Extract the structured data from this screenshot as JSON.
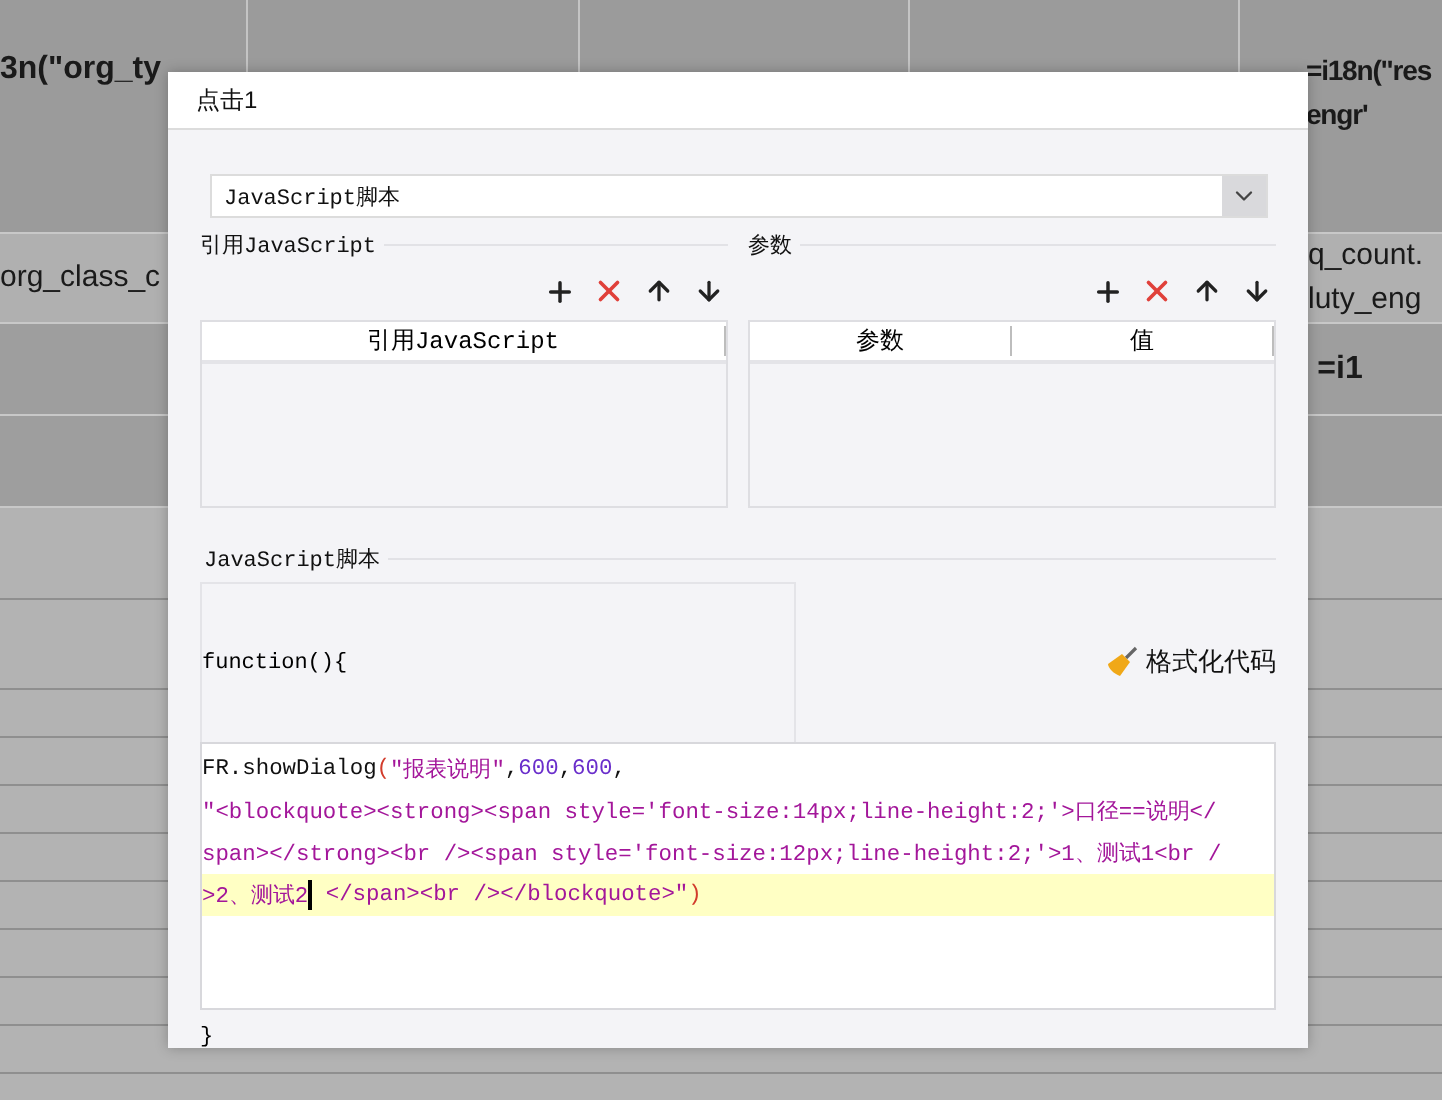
{
  "sheet": {
    "rows": [
      {
        "kind": "header",
        "cells": [
          "3n(\"org_ty",
          null,
          null,
          null,
          "=i18n(\"res\nengr'"
        ]
      },
      {
        "kind": "light",
        "cells": [
          "org_class_c",
          null,
          null,
          null,
          "q_count.\nluty_eng"
        ]
      },
      {
        "kind": "dark",
        "cells": [
          null,
          null,
          null,
          null,
          "=i1"
        ]
      },
      {
        "kind": "dark",
        "cells": [
          null,
          null,
          null,
          null,
          null
        ]
      }
    ]
  },
  "dialog": {
    "title": "点击1",
    "type_select": {
      "value": "JavaScript脚本"
    },
    "imports": {
      "heading": "引用JavaScript",
      "columns": [
        "引用JavaScript"
      ]
    },
    "params": {
      "heading": "参数",
      "columns": [
        "参数",
        "值"
      ]
    },
    "script": {
      "heading": "JavaScript脚本",
      "header_line": "function(){",
      "format_button": "格式化代码",
      "code_lines": [
        {
          "current": false,
          "tokens": [
            {
              "kind": "plain",
              "text": "FR.showDialog"
            },
            {
              "kind": "paren",
              "text": "("
            },
            {
              "kind": "string",
              "text": "\"报表说明\""
            },
            {
              "kind": "plain",
              "text": ","
            },
            {
              "kind": "number",
              "text": "600"
            },
            {
              "kind": "plain",
              "text": ","
            },
            {
              "kind": "number",
              "text": "600"
            },
            {
              "kind": "plain",
              "text": ","
            }
          ]
        },
        {
          "current": false,
          "tokens": [
            {
              "kind": "string",
              "text": "\"<blockquote><strong><span style='font-size:14px;line-height:2;'>口径==说明</"
            }
          ]
        },
        {
          "current": false,
          "tokens": [
            {
              "kind": "string",
              "text": "span></strong><br /><span style='font-size:12px;line-height:2;'>1、测试1<br /"
            }
          ]
        },
        {
          "current": true,
          "tokens": [
            {
              "kind": "string",
              "text": ">2、测试2"
            },
            {
              "kind": "cursor"
            },
            {
              "kind": "string",
              "text": " </span><br /></blockquote>\""
            },
            {
              "kind": "paren",
              "text": ")"
            }
          ]
        }
      ],
      "footer_line": "}"
    }
  }
}
